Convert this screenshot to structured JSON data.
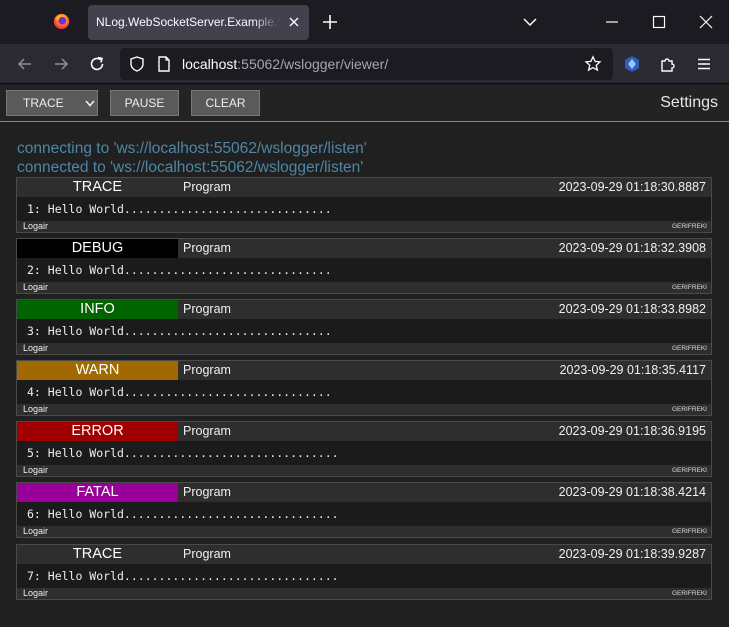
{
  "browser": {
    "tab_title": "NLog.WebSocketServer.Example.FullFramework",
    "url_host": "localhost",
    "url_rest": ":55062/wslogger/viewer/"
  },
  "toolbar": {
    "level_select": "TRACE",
    "pause_label": "PAUSE",
    "clear_label": "CLEAR",
    "settings_label": "Settings"
  },
  "status_lines": [
    "connecting to 'ws://localhost:55062/wslogger/listen'",
    "connected to 'ws://localhost:55062/wslogger/listen'"
  ],
  "entries": [
    {
      "level": "TRACE",
      "level_color": "#2e2e2e",
      "logger": "Program",
      "timestamp": "2023-09-29 01:18:30.8887",
      "message": "1: Hello World..............................",
      "source": "Logair",
      "machine": "GERIFREKI"
    },
    {
      "level": "DEBUG",
      "level_color": "#000000",
      "logger": "Program",
      "timestamp": "2023-09-29 01:18:32.3908",
      "message": "2: Hello World..............................",
      "source": "Logair",
      "machine": "GERIFREKI"
    },
    {
      "level": "INFO",
      "level_color": "#006400",
      "logger": "Program",
      "timestamp": "2023-09-29 01:18:33.8982",
      "message": "3: Hello World..............................",
      "source": "Logair",
      "machine": "GERIFREKI"
    },
    {
      "level": "WARN",
      "level_color": "#a06a00",
      "logger": "Program",
      "timestamp": "2023-09-29 01:18:35.4117",
      "message": "4: Hello World..............................",
      "source": "Logair",
      "machine": "GERIFREKI"
    },
    {
      "level": "ERROR",
      "level_color": "#a00000",
      "logger": "Program",
      "timestamp": "2023-09-29 01:18:36.9195",
      "message": "5: Hello World...............................",
      "source": "Logair",
      "machine": "GERIFREKI"
    },
    {
      "level": "FATAL",
      "level_color": "#990099",
      "logger": "Program",
      "timestamp": "2023-09-29 01:18:38.4214",
      "message": "6: Hello World...............................",
      "source": "Logair",
      "machine": "GERIFREKI"
    },
    {
      "level": "TRACE",
      "level_color": "#2e2e2e",
      "logger": "Program",
      "timestamp": "2023-09-29 01:18:39.9287",
      "message": "7: Hello World...............................",
      "source": "Logair",
      "machine": "GERIFREKI"
    }
  ],
  "icons": {
    "browser_logo": "firefox-logo-icon",
    "back": "back-arrow-icon",
    "forward": "forward-arrow-icon",
    "reload": "reload-icon",
    "site_info": "shield-icon",
    "page": "page-icon",
    "bookmark": "star-icon",
    "extension_user": "extension-badge-icon",
    "extensions": "puzzle-icon",
    "menu": "hamburger-menu-icon"
  }
}
